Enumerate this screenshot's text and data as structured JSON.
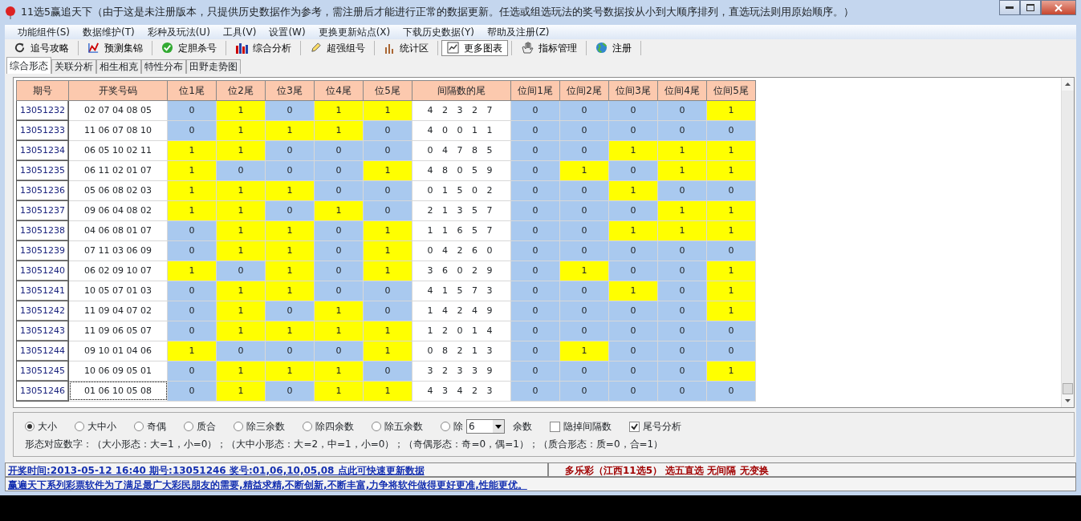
{
  "window": {
    "title": "11选5赢追天下（由于这是未注册版本，只提供历史数据作为参考，需注册后才能进行正常的数据更新。任选或组选玩法的奖号数据按从小到大顺序排列，直选玩法则用原始顺序。）"
  },
  "menu": [
    "功能组件(S)",
    "数据维护(T)",
    "彩种及玩法(U)",
    "工具(V)",
    "设置(W)",
    "更换更新站点(X)",
    "下载历史数据(Y)",
    "帮助及注册(Z)"
  ],
  "toolbar": [
    {
      "label": "追号攻略",
      "pressed": false
    },
    {
      "label": "预测集锦",
      "pressed": false
    },
    {
      "label": "定胆杀号",
      "pressed": false
    },
    {
      "label": "综合分析",
      "pressed": false
    },
    {
      "label": "超强组号",
      "pressed": false
    },
    {
      "label": "统计区",
      "pressed": false
    },
    {
      "label": "更多图表",
      "pressed": true
    },
    {
      "label": "指标管理",
      "pressed": false
    },
    {
      "label": "注册",
      "pressed": false
    }
  ],
  "tabs": [
    {
      "label": "综合形态",
      "selected": true
    },
    {
      "label": "关联分析",
      "selected": false
    },
    {
      "label": "相生相克",
      "selected": false
    },
    {
      "label": "特性分布",
      "selected": false
    },
    {
      "label": "田野走势图",
      "selected": false
    }
  ],
  "table": {
    "columns": [
      "期号",
      "开奖号码",
      "位1尾",
      "位2尾",
      "位3尾",
      "位4尾",
      "位5尾",
      "间隔数的尾",
      "位间1尾",
      "位间2尾",
      "位间3尾",
      "位间4尾",
      "位间5尾"
    ],
    "rows": [
      {
        "issue": "13051232",
        "numbers": "02 07 04 08 05",
        "tails": [
          "0",
          "1",
          "0",
          "1",
          "1"
        ],
        "gaps": "4 2 3 2 7",
        "gap_tails": [
          "0",
          "0",
          "0",
          "0",
          "1"
        ],
        "selected": false
      },
      {
        "issue": "13051233",
        "numbers": "11 06 07 08 10",
        "tails": [
          "0",
          "1",
          "1",
          "1",
          "0"
        ],
        "gaps": "4 0 0 1 1",
        "gap_tails": [
          "0",
          "0",
          "0",
          "0",
          "0"
        ],
        "selected": false
      },
      {
        "issue": "13051234",
        "numbers": "06 05 10 02 11",
        "tails": [
          "1",
          "1",
          "0",
          "0",
          "0"
        ],
        "gaps": "0 4 7 8 5",
        "gap_tails": [
          "0",
          "0",
          "1",
          "1",
          "1"
        ],
        "selected": false
      },
      {
        "issue": "13051235",
        "numbers": "06 11 02 01 07",
        "tails": [
          "1",
          "0",
          "0",
          "0",
          "1"
        ],
        "gaps": "4 8 0 5 9",
        "gap_tails": [
          "0",
          "1",
          "0",
          "1",
          "1"
        ],
        "selected": false
      },
      {
        "issue": "13051236",
        "numbers": "05 06 08 02 03",
        "tails": [
          "1",
          "1",
          "1",
          "0",
          "0"
        ],
        "gaps": "0 1 5 0 2",
        "gap_tails": [
          "0",
          "0",
          "1",
          "0",
          "0"
        ],
        "selected": false
      },
      {
        "issue": "13051237",
        "numbers": "09 06 04 08 02",
        "tails": [
          "1",
          "1",
          "0",
          "1",
          "0"
        ],
        "gaps": "2 1 3 5 7",
        "gap_tails": [
          "0",
          "0",
          "0",
          "1",
          "1"
        ],
        "selected": false
      },
      {
        "issue": "13051238",
        "numbers": "04 06 08 01 07",
        "tails": [
          "0",
          "1",
          "1",
          "0",
          "1"
        ],
        "gaps": "1 1 6 5 7",
        "gap_tails": [
          "0",
          "0",
          "1",
          "1",
          "1"
        ],
        "selected": false
      },
      {
        "issue": "13051239",
        "numbers": "07 11 03 06 09",
        "tails": [
          "0",
          "1",
          "1",
          "0",
          "1"
        ],
        "gaps": "0 4 2 6 0",
        "gap_tails": [
          "0",
          "0",
          "0",
          "0",
          "0"
        ],
        "selected": false
      },
      {
        "issue": "13051240",
        "numbers": "06 02 09 10 07",
        "tails": [
          "1",
          "0",
          "1",
          "0",
          "1"
        ],
        "gaps": "3 6 0 2 9",
        "gap_tails": [
          "0",
          "1",
          "0",
          "0",
          "1"
        ],
        "selected": false
      },
      {
        "issue": "13051241",
        "numbers": "10 05 07 01 03",
        "tails": [
          "0",
          "1",
          "1",
          "0",
          "0"
        ],
        "gaps": "4 1 5 7 3",
        "gap_tails": [
          "0",
          "0",
          "1",
          "0",
          "1"
        ],
        "selected": false
      },
      {
        "issue": "13051242",
        "numbers": "11 09 04 07 02",
        "tails": [
          "0",
          "1",
          "0",
          "1",
          "0"
        ],
        "gaps": "1 4 2 4 9",
        "gap_tails": [
          "0",
          "0",
          "0",
          "0",
          "1"
        ],
        "selected": false
      },
      {
        "issue": "13051243",
        "numbers": "11 09 06 05 07",
        "tails": [
          "0",
          "1",
          "1",
          "1",
          "1"
        ],
        "gaps": "1 2 0 1 4",
        "gap_tails": [
          "0",
          "0",
          "0",
          "0",
          "0"
        ],
        "selected": false
      },
      {
        "issue": "13051244",
        "numbers": "09 10 01 04 06",
        "tails": [
          "1",
          "0",
          "0",
          "0",
          "1"
        ],
        "gaps": "0 8 2 1 3",
        "gap_tails": [
          "0",
          "1",
          "0",
          "0",
          "0"
        ],
        "selected": false
      },
      {
        "issue": "13051245",
        "numbers": "10 06 09 05 01",
        "tails": [
          "0",
          "1",
          "1",
          "1",
          "0"
        ],
        "gaps": "3 2 3 3 9",
        "gap_tails": [
          "0",
          "0",
          "0",
          "0",
          "1"
        ],
        "selected": false
      },
      {
        "issue": "13051246",
        "numbers": "01 06 10 05 08",
        "tails": [
          "0",
          "1",
          "0",
          "1",
          "1"
        ],
        "gaps": "4 3 4 2 3",
        "gap_tails": [
          "0",
          "0",
          "0",
          "0",
          "0"
        ],
        "selected": true
      }
    ]
  },
  "options": [
    {
      "kind": "radio",
      "label": "大小",
      "selected": true
    },
    {
      "kind": "radio",
      "label": "大中小",
      "selected": false
    },
    {
      "kind": "radio",
      "label": "奇偶",
      "selected": false
    },
    {
      "kind": "radio",
      "label": "质合",
      "selected": false
    },
    {
      "kind": "radio",
      "label": "除三余数",
      "selected": false
    },
    {
      "kind": "radio",
      "label": "除四余数",
      "selected": false
    },
    {
      "kind": "radio",
      "label": "除五余数",
      "selected": false
    },
    {
      "kind": "radio",
      "label": "除",
      "selected": false
    },
    {
      "kind": "select",
      "value": "6"
    },
    {
      "kind": "text",
      "label": "余数"
    },
    {
      "kind": "checkbox",
      "label": "隐掉间隔数",
      "checked": false
    },
    {
      "kind": "checkbox",
      "label": "尾号分析",
      "checked": true
    }
  ],
  "legend": "形态对应数字：（大小形态：大=1，小=0）；（大中小形态：大=2，中=1，小=0）；（奇偶形态：奇=0，偶=1）；（质合形态：质=0，合=1）",
  "status_bar": {
    "draw_info": "开奖时间:2013-05-12 16:40 期号:13051246 奖号:01,06,10,05,08 点此可快速更新数据",
    "game": "多乐彩（江西11选5） 选五直选 无间隔 无变换",
    "slogan": "赢遍天下系列彩票软件为了满足最广大彩民朋友的需要,精益求精,不断创新,不断丰富,力争将软件做得更好更准,性能更优。"
  }
}
